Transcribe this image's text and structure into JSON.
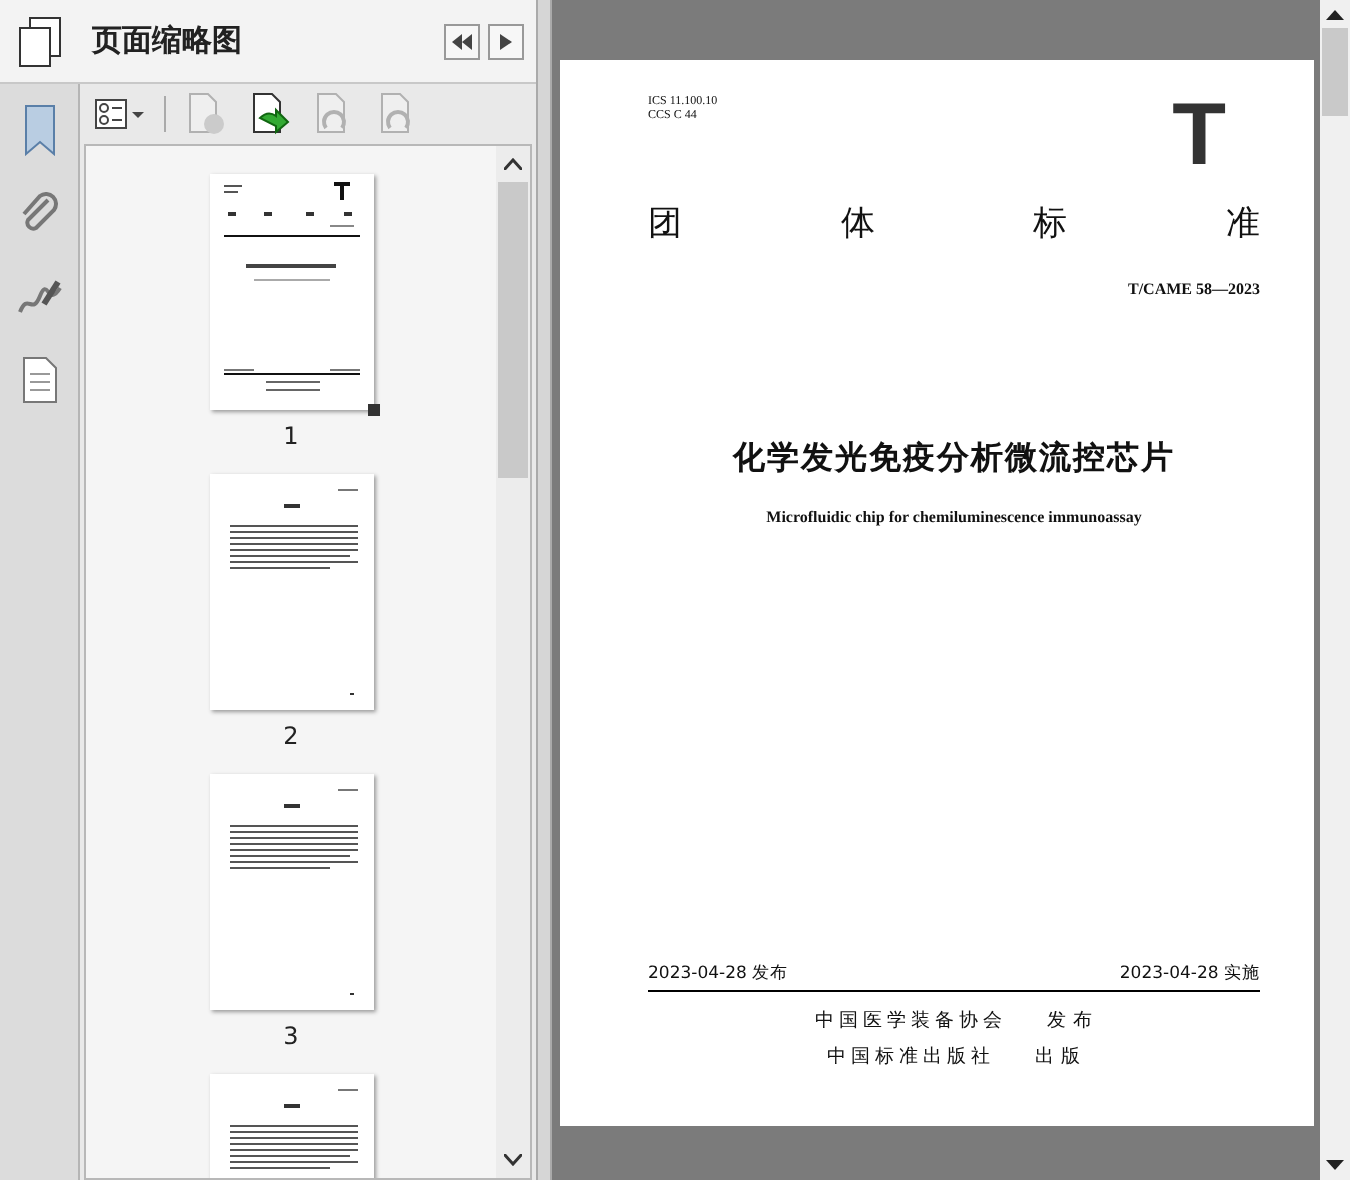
{
  "panel": {
    "title": "页面缩略图"
  },
  "toolbar": [
    {
      "kind": "options",
      "disabled": false
    },
    {
      "kind": "delete",
      "disabled": true
    },
    {
      "kind": "insert",
      "disabled": false
    },
    {
      "kind": "undo",
      "disabled": true
    },
    {
      "kind": "redo",
      "disabled": true
    }
  ],
  "thumbnails": [
    {
      "kind": "cover",
      "label": "1",
      "selected": true
    },
    {
      "kind": "text",
      "label": "2",
      "selected": false
    },
    {
      "kind": "text",
      "label": "3",
      "selected": false
    },
    {
      "kind": "text"
    }
  ],
  "document": {
    "ics": "ICS 11.100.10",
    "ccs": "CCS C 44",
    "logo": "T",
    "heading_chars": [
      "团",
      "体",
      "标",
      "准"
    ],
    "code": "T/CAME 58—2023",
    "title": "化学发光免疫分析微流控芯片",
    "subtitle": "Microfluidic chip for chemiluminescence immunoassay",
    "publish_date": "2023-04-28 发布",
    "effective_date": "2023-04-28 实施",
    "publishers": [
      {
        "name": "中国医学装备协会",
        "role": "发 布"
      },
      {
        "name": "中国标准出版社",
        "role": "出 版"
      }
    ]
  }
}
